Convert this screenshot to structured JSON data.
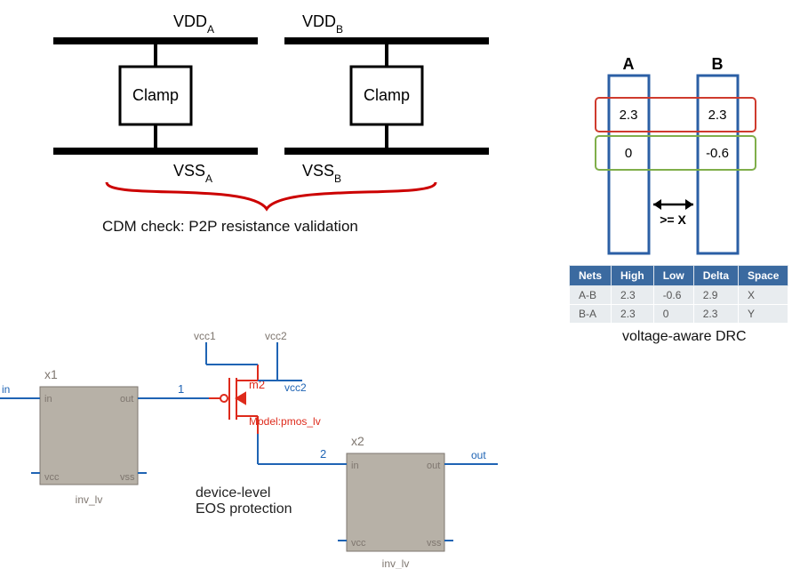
{
  "domain": "Diagram",
  "top_schematic": {
    "rails": {
      "vdd_a": "VDD",
      "vdd_b": "VDD",
      "vss_a": "VSS",
      "vss_b": "VSS",
      "sub_a": "A",
      "sub_b": "B"
    },
    "clamp_label": "Clamp",
    "caption": "CDM check: P2P resistance validation"
  },
  "voltage_aware_drc": {
    "columns": {
      "a": "A",
      "b": "B"
    },
    "row1": {
      "a": "2.3",
      "b": "2.3"
    },
    "row2": {
      "a": "0",
      "b": "-0.6"
    },
    "spacing_label": ">= X",
    "caption": "voltage-aware DRC",
    "table": {
      "headers": {
        "nets": "Nets",
        "high": "High",
        "low": "Low",
        "delta": "Delta",
        "space": "Space"
      },
      "r1": {
        "nets": "A-B",
        "high": "2.3",
        "low": "-0.6",
        "delta": "2.9",
        "space": "X"
      },
      "r2": {
        "nets": "B-A",
        "high": "2.3",
        "low": "0",
        "delta": "2.3",
        "space": "Y"
      }
    }
  },
  "bottom_schematic": {
    "x1": {
      "name": "x1",
      "type": "inv_lv",
      "pins": {
        "in": "in",
        "out": "out",
        "vcc": "vcc",
        "vss": "vss"
      }
    },
    "x2": {
      "name": "x2",
      "type": "inv_lv",
      "pins": {
        "in": "in",
        "out": "out",
        "vcc": "vcc",
        "vss": "vss"
      }
    },
    "m2": {
      "name": "m2",
      "model_pfx": "Model:",
      "model": "pmos_lv"
    },
    "nets": {
      "n1": "1",
      "n2": "2",
      "vcc1": "vcc1",
      "vcc2": "vcc2",
      "vcc2b": "vcc2",
      "ext_in": "in",
      "ext_out": "out"
    },
    "caption_l1": "device-level",
    "caption_l2": "EOS protection"
  },
  "chart_data": {
    "type": "table",
    "title": "voltage-aware DRC",
    "columns": [
      "Nets",
      "High",
      "Low",
      "Delta",
      "Space"
    ],
    "rows": [
      [
        "A-B",
        2.3,
        -0.6,
        2.9,
        "X"
      ],
      [
        "B-A",
        2.3,
        0,
        2.3,
        "Y"
      ]
    ]
  }
}
